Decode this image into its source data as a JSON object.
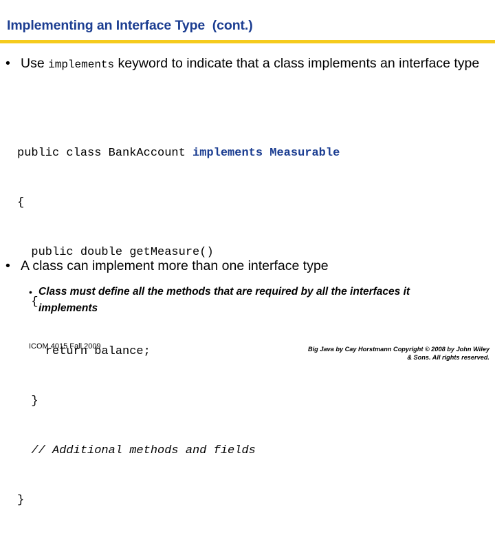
{
  "slide": {
    "title": "Implementing an Interface Type  (cont.)",
    "accent_color": "#f5cb1d",
    "title_color": "#1b3d91"
  },
  "bullets": [
    {
      "level": 1,
      "marker": "•",
      "text_before": "Use ",
      "mono": "implements",
      "text_after": " keyword to indicate that a class implements an interface type"
    },
    {
      "level": 1,
      "marker": "•",
      "text": "A class can implement more than one interface type"
    },
    {
      "level": 2,
      "marker": "•",
      "text": "Class must define all the methods that are required by all the interfaces it implements"
    }
  ],
  "code": {
    "line1_plain": "public class BankAccount ",
    "line1_keyword": "implements Measurable",
    "line2": "{",
    "line3": "  public double getMeasure()",
    "line4": "  {",
    "line5": "    return balance;",
    "line6": "  }",
    "line7": "  // Additional methods and fields",
    "line8": "}"
  },
  "footer": {
    "course": "ICOM 4015 Fall 2009",
    "copyright_line1": "Big Java by Cay Horstmann Copyright © 2008 by John Wiley",
    "copyright_line2": "& Sons.  All rights reserved."
  }
}
